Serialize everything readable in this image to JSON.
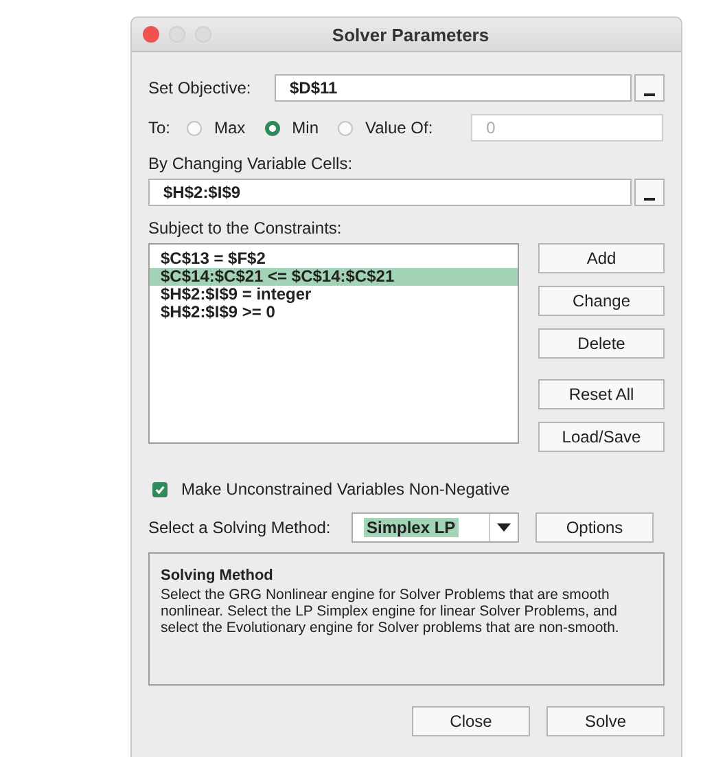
{
  "window": {
    "title": "Solver Parameters"
  },
  "objective": {
    "label": "Set Objective:",
    "value": "$D$11"
  },
  "to": {
    "label": "To:",
    "options": [
      {
        "label": "Max",
        "selected": false
      },
      {
        "label": "Min",
        "selected": true
      },
      {
        "label": "Value Of:",
        "selected": false
      }
    ],
    "value_field": "0"
  },
  "changing_cells": {
    "label": "By Changing Variable Cells:",
    "value": "$H$2:$I$9"
  },
  "constraints": {
    "label": "Subject to the Constraints:",
    "items": [
      {
        "text": "$C$13 = $F$2",
        "selected": false
      },
      {
        "text": "$C$14:$C$21 <= $C$14:$C$21",
        "selected": true
      },
      {
        "text": "$H$2:$I$9 = integer",
        "selected": false
      },
      {
        "text": "$H$2:$I$9 >= 0",
        "selected": false
      }
    ],
    "buttons": [
      "Add",
      "Change",
      "Delete",
      "Reset All",
      "Load/Save"
    ]
  },
  "non_negative": {
    "label": "Make Unconstrained Variables Non-Negative",
    "checked": true
  },
  "method": {
    "label": "Select a Solving Method:",
    "value": "Simplex LP",
    "options_button": "Options"
  },
  "description": {
    "title": "Solving Method",
    "text": "Select the GRG Nonlinear engine for Solver Problems that are smooth nonlinear. Select the LP Simplex engine for linear Solver Problems, and select the Evolutionary engine for Solver problems that are non-smooth."
  },
  "footer_buttons": [
    "Close",
    "Solve"
  ]
}
